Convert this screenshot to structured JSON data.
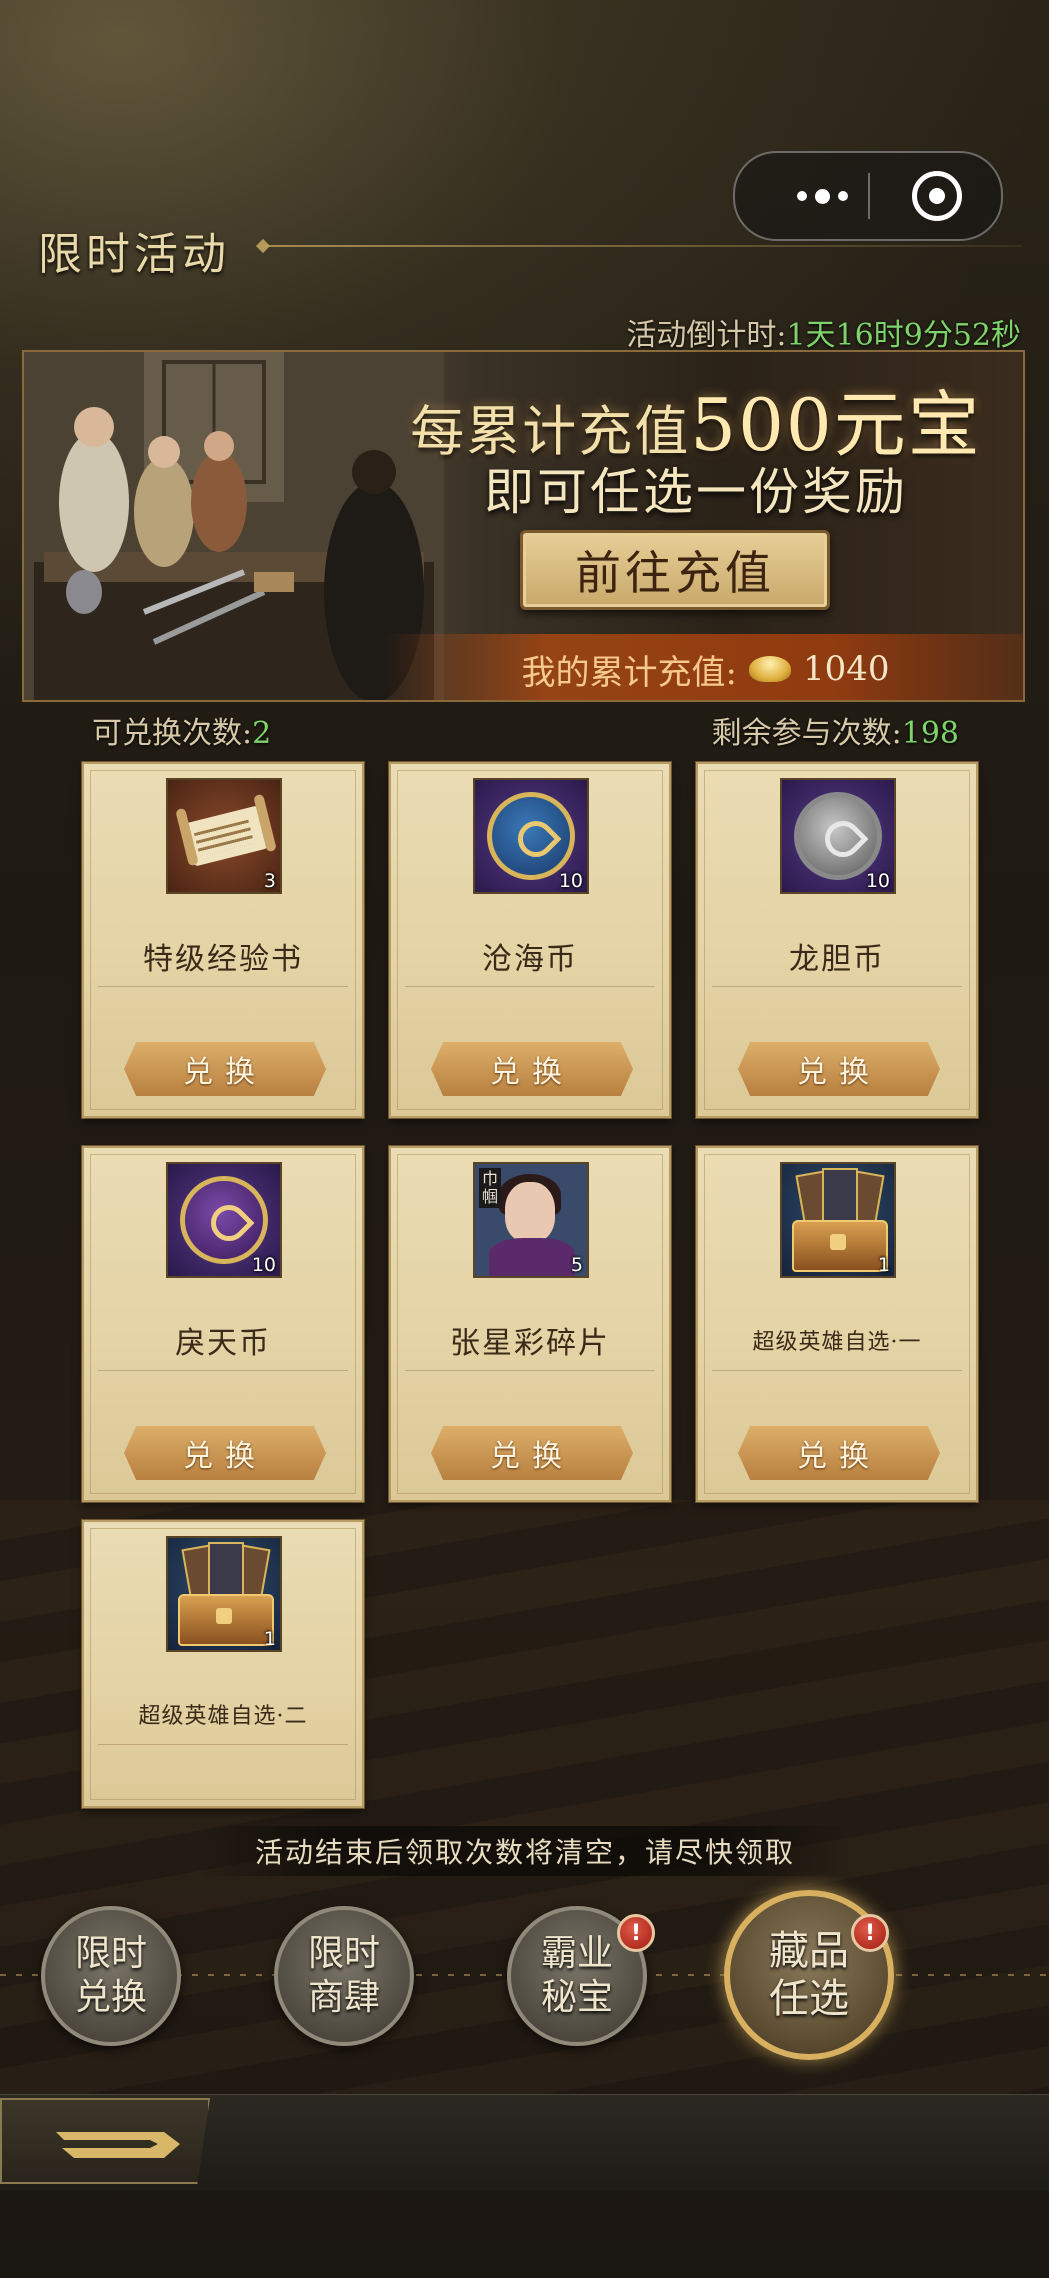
{
  "header": {
    "title": "限时活动",
    "capsule": {
      "more_icon": "more-dots-icon",
      "close_icon": "target-close-icon"
    }
  },
  "countdown": {
    "label": "活动倒计时:",
    "value": "1天16时9分52秒"
  },
  "banner": {
    "headline_prefix": "每累计充值",
    "headline_amount": "500元宝",
    "subline": "即可任选一份奖励",
    "recharge_button": "前往充值",
    "total_label": "我的累计充值:",
    "total_value": "1040",
    "currency_icon": "gold-ingot-icon"
  },
  "counts": {
    "exchangeable_label": "可兑换次数:",
    "exchangeable_value": "2",
    "remaining_label": "剩余参与次数:",
    "remaining_value": "198"
  },
  "items": [
    {
      "name": "特级经验书",
      "qty": "3",
      "icon": "exp-scroll-icon",
      "button": "兑换"
    },
    {
      "name": "沧海币",
      "qty": "10",
      "icon": "canghai-coin-icon",
      "button": "兑换"
    },
    {
      "name": "龙胆币",
      "qty": "10",
      "icon": "longdan-coin-icon",
      "button": "兑换"
    },
    {
      "name": "戾天币",
      "qty": "10",
      "icon": "litian-coin-icon",
      "button": "兑换"
    },
    {
      "name": "张星彩碎片",
      "qty": "5",
      "icon": "hero-shard-icon",
      "icon_tag": "巾帼",
      "button": "兑换"
    },
    {
      "name": "超级英雄自选·一",
      "qty": "1",
      "icon": "hero-chest-icon",
      "button": "兑换"
    },
    {
      "name": "超级英雄自选·二",
      "qty": "1",
      "icon": "hero-chest-icon"
    }
  ],
  "notice": "活动结束后领取次数将清空，请尽快领取",
  "bottom_nav": [
    {
      "label_1": "限时",
      "label_2": "兑换",
      "active": false,
      "badge": ""
    },
    {
      "label_1": "限时",
      "label_2": "商肆",
      "active": false,
      "badge": ""
    },
    {
      "label_1": "霸业",
      "label_2": "秘宝",
      "active": false,
      "badge": "!"
    },
    {
      "label_1": "藏品",
      "label_2": "任选",
      "active": true,
      "badge": "!"
    }
  ],
  "back_button": {
    "icon": "back-arrow-icon"
  },
  "colors": {
    "accent_green": "#7ed36a",
    "card_bg": "#e4d3a5",
    "button_gold": "#c9955a",
    "badge_red": "#c0301e"
  }
}
